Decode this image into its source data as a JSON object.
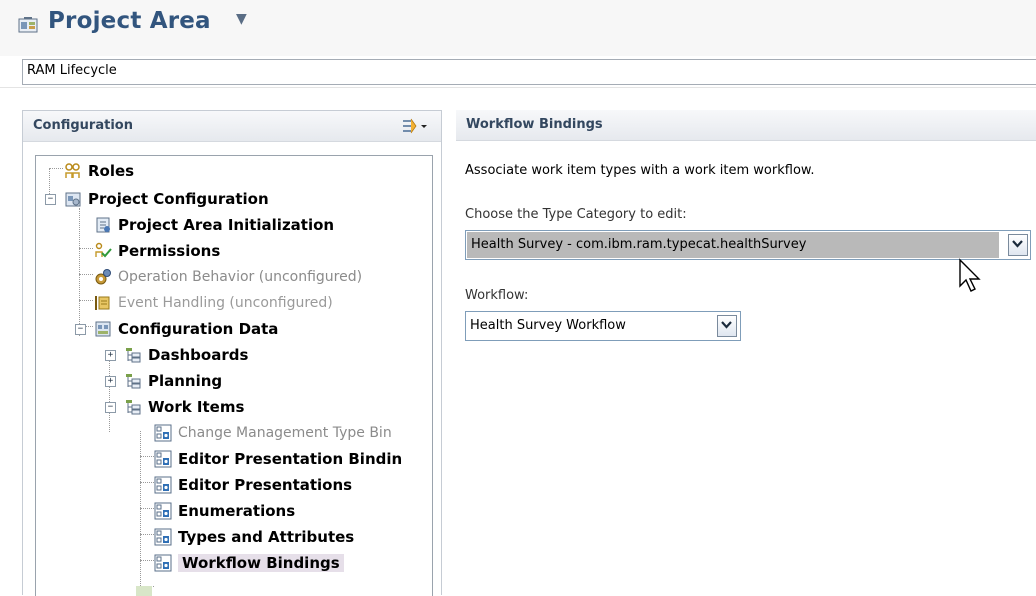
{
  "header": {
    "title": "Project Area",
    "project_name": "RAM Lifecycle"
  },
  "configuration": {
    "title": "Configuration",
    "tree": [
      {
        "label": "Roles",
        "style": "bold",
        "icon": "roles-icon"
      },
      {
        "label": "Project Configuration",
        "style": "bold",
        "icon": "project-configuration-icon",
        "expanded": true
      },
      {
        "label": "Project Area Initialization",
        "style": "bold",
        "icon": "initialization-icon"
      },
      {
        "label": "Permissions",
        "style": "bold",
        "icon": "permissions-icon"
      },
      {
        "label": "Operation Behavior (unconfigured)",
        "style": "gray",
        "icon": "operation-behavior-icon"
      },
      {
        "label": "Event Handling (unconfigured)",
        "style": "gray",
        "icon": "event-handling-icon"
      },
      {
        "label": "Configuration Data",
        "style": "bold",
        "icon": "configuration-data-icon",
        "expanded": true
      },
      {
        "label": "Dashboards",
        "style": "bold",
        "icon": "dashboards-icon",
        "expanded": false
      },
      {
        "label": "Planning",
        "style": "bold",
        "icon": "planning-icon",
        "expanded": false
      },
      {
        "label": "Work Items",
        "style": "bold",
        "icon": "work-items-icon",
        "expanded": true
      },
      {
        "label": "Change Management Type Bin",
        "style": "gray",
        "icon": "binding-icon"
      },
      {
        "label": "Editor Presentation Bindin",
        "style": "bold",
        "icon": "binding-icon"
      },
      {
        "label": "Editor Presentations",
        "style": "bold",
        "icon": "binding-icon"
      },
      {
        "label": "Enumerations",
        "style": "bold",
        "icon": "binding-icon"
      },
      {
        "label": "Types and Attributes",
        "style": "bold",
        "icon": "binding-icon"
      },
      {
        "label": "Workflow Bindings",
        "style": "bold",
        "icon": "binding-icon",
        "selected": true
      }
    ]
  },
  "workflow_bindings": {
    "title": "Workflow Bindings",
    "description": "Associate work item types with a work item workflow.",
    "type_category_label": "Choose the Type Category to edit:",
    "type_category_value": "Health Survey - com.ibm.ram.typecat.healthSurvey",
    "workflow_label": "Workflow:",
    "workflow_value": "Health Survey Workflow"
  },
  "colors": {
    "title": "#32557e",
    "section_header": "#33475f",
    "selection": "#e6dfe9"
  }
}
